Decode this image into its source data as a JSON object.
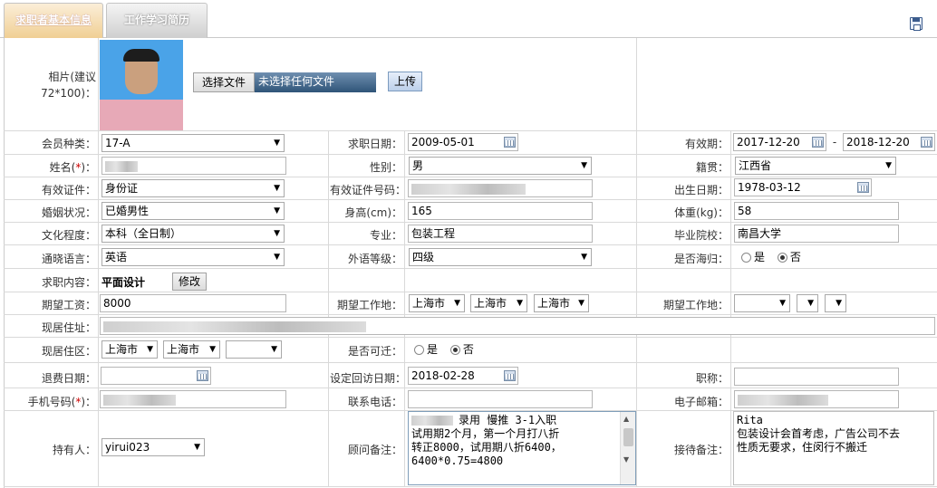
{
  "tabs": {
    "basic_info": "求职者基本信息",
    "work_history": "工作学习简历"
  },
  "photo": {
    "label_line1": "相片(建议",
    "label_line2": "72*100)：",
    "choose_file": "选择文件",
    "no_file": "未选择任何文件",
    "upload": "上传"
  },
  "row1": {
    "member_type_label": "会员种类：",
    "member_type": "17-A",
    "apply_date_label": "求职日期：",
    "apply_date": "2009-05-01",
    "valid_label": "有效期：",
    "valid_from": "2017-12-20",
    "dash": "-",
    "valid_to": "2018-12-20"
  },
  "row2": {
    "name_label": "姓名(",
    "name_star": "*",
    "name_label_end": ")：",
    "gender_label": "性别：",
    "gender": "男",
    "origin_label": "籍贯：",
    "origin": "江西省"
  },
  "row3": {
    "id_type_label": "有效证件：",
    "id_type": "身份证",
    "id_no_label": "有效证件号码：",
    "birth_label": "出生日期：",
    "birth": "1978-03-12"
  },
  "row4": {
    "marital_label": "婚姻状况：",
    "marital": "已婚男性",
    "height_label": "身高(cm)：",
    "height": "165",
    "weight_label": "体重(kg)：",
    "weight": "58"
  },
  "row5": {
    "edu_label": "文化程度：",
    "edu": "本科（全日制）",
    "major_label": "专业：",
    "major": "包装工程",
    "school_label": "毕业院校：",
    "school": "南昌大学"
  },
  "row6": {
    "lang_label": "通晓语言：",
    "lang": "英语",
    "lang_level_label": "外语等级：",
    "lang_level": "四级",
    "overseas_label": "是否海归：",
    "yes": "是",
    "no": "否"
  },
  "row7": {
    "job_label": "求职内容：",
    "job": "平面设计",
    "modify": "修改"
  },
  "row8": {
    "salary_label": "期望工资：",
    "salary": "8000",
    "loc1_label": "期望工作地：",
    "loc1_a": "上海市",
    "loc1_b": "上海市",
    "loc1_c": "上海市",
    "loc2_label": "期望工作地："
  },
  "row9": {
    "address_label": "现居住址："
  },
  "row10": {
    "area_label": "现居住区：",
    "area_a": "上海市",
    "area_b": "上海市",
    "relocate_label": "是否可迁：",
    "yes": "是",
    "no": "否"
  },
  "row11": {
    "refund_label": "退费日期：",
    "revisit_label": "设定回访日期：",
    "revisit": "2018-02-28",
    "title_label": "职称："
  },
  "row12": {
    "phone_label": "手机号码(",
    "phone_star": "*",
    "phone_label_end": ")：",
    "tel_label": "联系电话：",
    "email_label": "电子邮箱："
  },
  "row13": {
    "holder_label": "持有人：",
    "holder": "yirui023",
    "consultant_label": "顾问备注：",
    "consultant_note": "录用 慢推 3-1入职\n试用期2个月，第一个月打八折\n转正8000，试用期八折6400，\n6400*0.75=4800",
    "reception_label": "接待备注：",
    "reception_note": "Rita\n包装设计会首考虑，广告公司不去\n性质无要求，住闵行不搬迁"
  },
  "colors": {
    "tab_active": "#f0cf94",
    "required": "#cc0000",
    "border": "#d9d9d9"
  }
}
